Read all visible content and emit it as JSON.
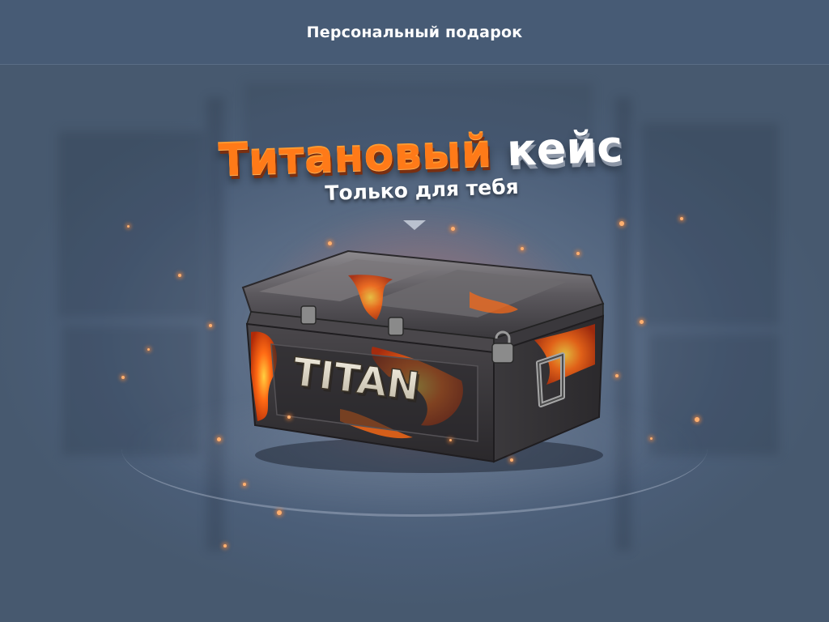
{
  "header": {
    "title": "Персональный подарок"
  },
  "promo": {
    "title_part1": "Титановый",
    "title_part2": "кейс",
    "subtitle": "Только для тебя"
  },
  "case_item": {
    "label": "TITAN"
  },
  "colors": {
    "header_bg": "#475b75",
    "title_orange": "#ff7a18",
    "title_white": "#ffffff",
    "lava": "#ff5a14"
  }
}
